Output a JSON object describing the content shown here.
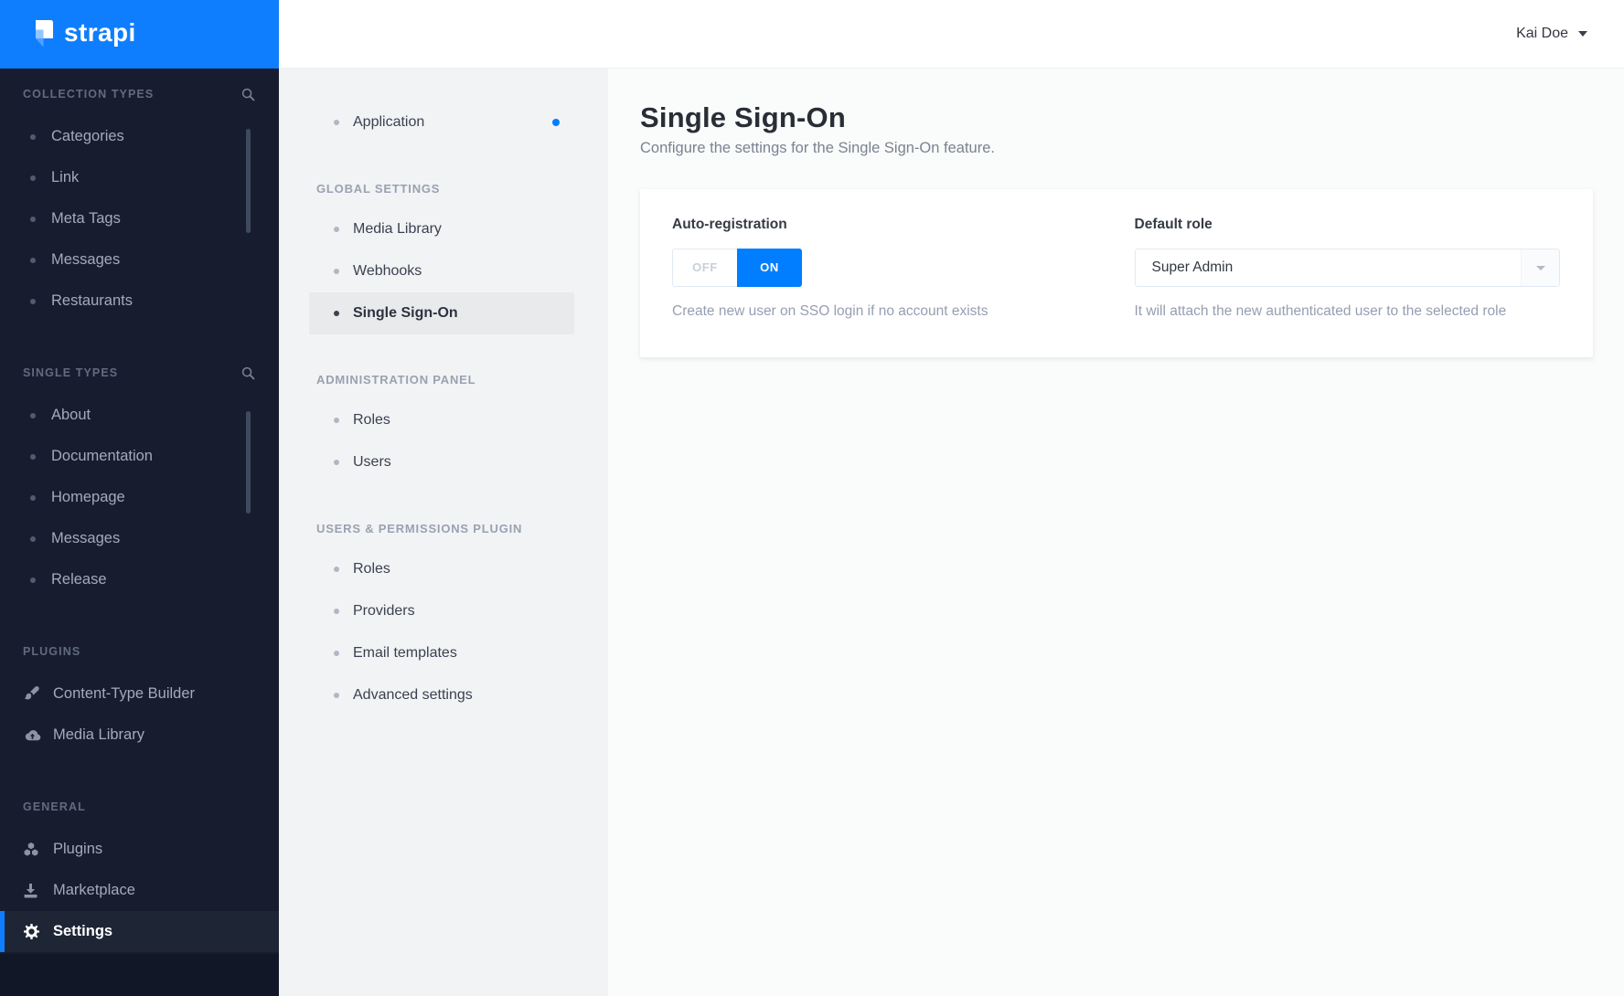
{
  "brand": {
    "logo_text": "strapi",
    "logo_icon": "strapi-flag-icon"
  },
  "colors": {
    "accent": "#007eff",
    "logo_bg": "#0e7eff",
    "sidebar_bg": "#171d2f",
    "settings_menu_bg": "#f2f3f4",
    "main_bg": "#fafbfb"
  },
  "topbar": {
    "user": "Kai Doe",
    "caret_icon": "chevron-down-icon"
  },
  "left_sidebar": {
    "sections": [
      {
        "title": "COLLECTION TYPES",
        "search_icon": "search-icon",
        "items": [
          {
            "label": "Categories"
          },
          {
            "label": "Link"
          },
          {
            "label": "Meta Tags"
          },
          {
            "label": "Messages"
          },
          {
            "label": "Restaurants"
          }
        ]
      },
      {
        "title": "SINGLE TYPES",
        "search_icon": "search-icon",
        "items": [
          {
            "label": "About"
          },
          {
            "label": "Documentation"
          },
          {
            "label": "Homepage"
          },
          {
            "label": "Messages"
          },
          {
            "label": "Release"
          }
        ]
      },
      {
        "title": "PLUGINS",
        "items": [
          {
            "label": "Content-Type Builder",
            "icon": "paintbrush-icon"
          },
          {
            "label": "Media Library",
            "icon": "cloud-upload-icon"
          }
        ]
      },
      {
        "title": "GENERAL",
        "items": [
          {
            "label": "Plugins",
            "icon": "cubes-icon"
          },
          {
            "label": "Marketplace",
            "icon": "download-icon"
          },
          {
            "label": "Settings",
            "icon": "gear-icon",
            "active": true
          }
        ]
      }
    ]
  },
  "settings_nav": {
    "standalone": [
      {
        "label": "Application",
        "has_notification": true
      }
    ],
    "sections": [
      {
        "title": "GLOBAL SETTINGS",
        "items": [
          {
            "label": "Media Library"
          },
          {
            "label": "Webhooks"
          },
          {
            "label": "Single Sign-On",
            "active": true
          }
        ]
      },
      {
        "title": "ADMINISTRATION PANEL",
        "items": [
          {
            "label": "Roles"
          },
          {
            "label": "Users"
          }
        ]
      },
      {
        "title": "USERS & PERMISSIONS PLUGIN",
        "items": [
          {
            "label": "Roles"
          },
          {
            "label": "Providers"
          },
          {
            "label": "Email templates"
          },
          {
            "label": "Advanced settings"
          }
        ]
      }
    ]
  },
  "page": {
    "title": "Single Sign-On",
    "subtitle": "Configure the settings for the Single Sign-On feature."
  },
  "form": {
    "auto_registration": {
      "label": "Auto-registration",
      "off_label": "OFF",
      "on_label": "ON",
      "value": "ON",
      "hint": "Create new user on SSO login if no account exists"
    },
    "default_role": {
      "label": "Default role",
      "value": "Super Admin",
      "hint": "It will attach the new authenticated user to the selected role"
    }
  }
}
